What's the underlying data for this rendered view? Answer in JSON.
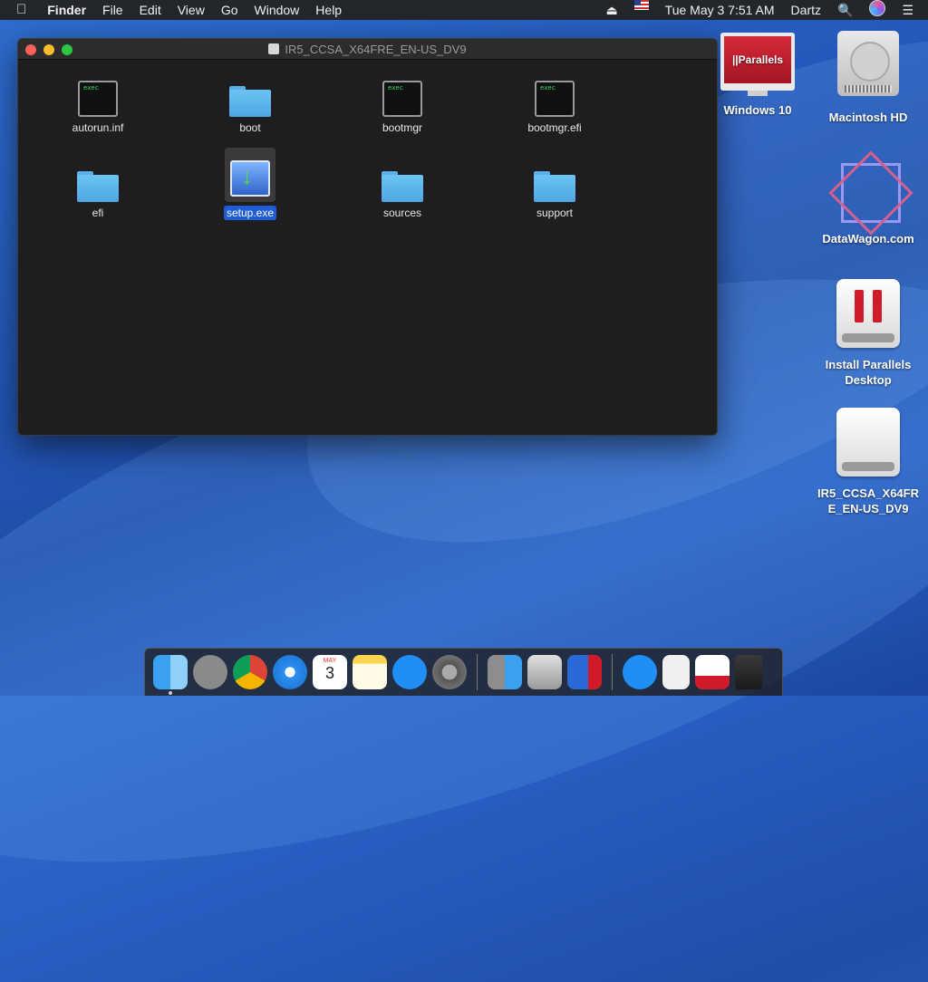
{
  "menubar": {
    "app_name": "Finder",
    "menus": [
      "File",
      "Edit",
      "View",
      "Go",
      "Window",
      "Help"
    ],
    "datetime": "Tue May 3  7:51 AM",
    "user": "Dartz"
  },
  "window": {
    "title": "IR5_CCSA_X64FRE_EN-US_DV9",
    "files": [
      {
        "name": "autorun.inf",
        "icon": "exec-icon"
      },
      {
        "name": "boot",
        "icon": "folder-icon"
      },
      {
        "name": "bootmgr",
        "icon": "exec-icon"
      },
      {
        "name": "bootmgr.efi",
        "icon": "exec-icon"
      },
      {
        "name": "efi",
        "icon": "folder-icon"
      },
      {
        "name": "setup.exe",
        "icon": "setup-icon",
        "selected": true
      },
      {
        "name": "sources",
        "icon": "folder-icon"
      },
      {
        "name": "support",
        "icon": "folder-icon"
      }
    ],
    "exec_badge": "exec"
  },
  "desktop": {
    "icons": [
      {
        "label": "Windows 10",
        "icon": "parallels-vm-icon",
        "screen_text": "||Parallels"
      },
      {
        "label": "Macintosh HD",
        "icon": "hard-drive-icon"
      },
      {
        "label": "DataWagon.com",
        "icon": "datawagon-icon"
      },
      {
        "label": "Install Parallels Desktop",
        "icon": "parallels-installer-icon"
      },
      {
        "label": "IR5_CCSA_X64FRE_EN-US_DV9",
        "icon": "disk-image-icon"
      }
    ]
  },
  "dock": {
    "apps": [
      "finder",
      "launchpad",
      "chrome",
      "safari",
      "calendar",
      "notes",
      "app-store",
      "system-preferences",
      "migration-assistant",
      "boot-camp-assistant",
      "parallels-desktop",
      "app-store-downloads",
      "document",
      "parallels-access",
      "trash"
    ],
    "calendar": {
      "month": "MAY",
      "day": "3"
    }
  },
  "colors": {
    "selection": "#1f5dd6",
    "folder": "#5ab0e8",
    "desktop": "#2558bb"
  }
}
